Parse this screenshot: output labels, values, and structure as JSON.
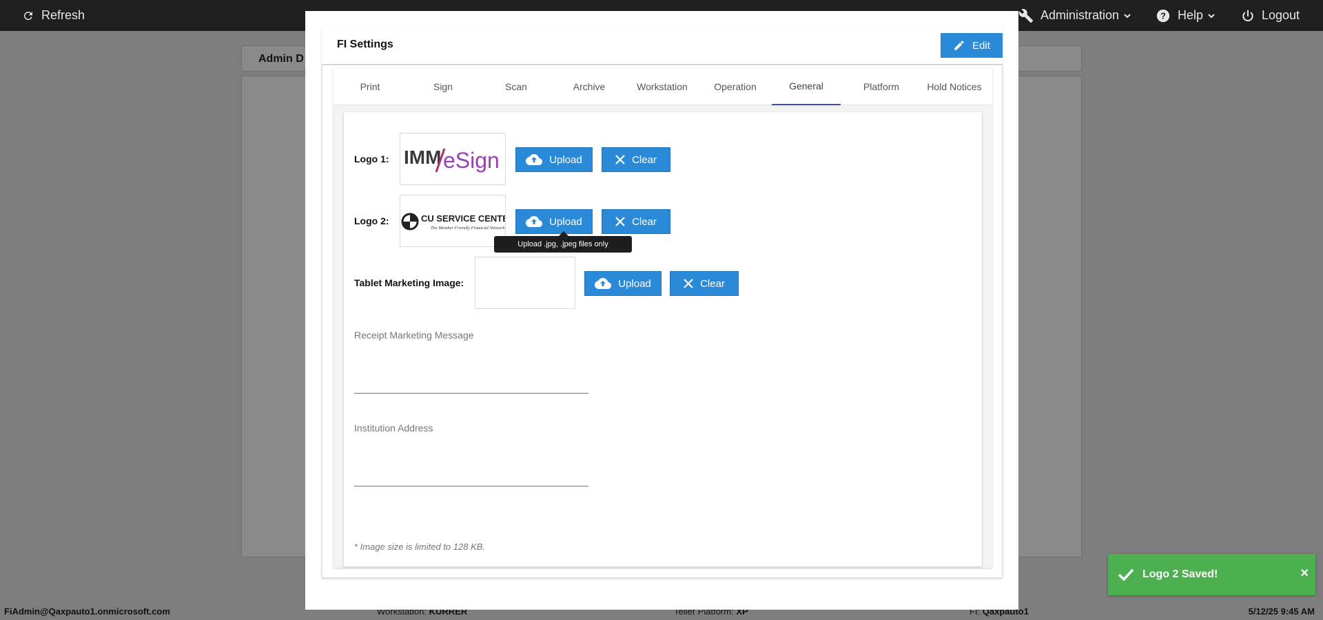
{
  "topbar": {
    "refresh_label": "Refresh",
    "admin_label": "Administration",
    "help_label": "Help",
    "logout_label": "Logout"
  },
  "background": {
    "card_title": "Admin D"
  },
  "modal": {
    "title": "FI Settings",
    "edit_label": "Edit",
    "tabs": [
      {
        "label": "Print"
      },
      {
        "label": "Sign"
      },
      {
        "label": "Scan"
      },
      {
        "label": "Archive"
      },
      {
        "label": "Workstation"
      },
      {
        "label": "Operation"
      },
      {
        "label": "General"
      },
      {
        "label": "Platform"
      },
      {
        "label": "Hold Notices"
      }
    ],
    "active_tab": "General",
    "logo1": {
      "label": "Logo 1:",
      "image_text": "IMM/eSign"
    },
    "logo2": {
      "label": "Logo 2:",
      "image_text": "CU SERVICE CENTERS",
      "image_subtext": "The Member Friendly Financial Network"
    },
    "tablet": {
      "label": "Tablet Marketing Image:"
    },
    "upload_label": "Upload",
    "clear_label": "Clear",
    "tooltip": "Upload .jpg, .jpeg files only",
    "receipt_label": "Receipt Marketing Message",
    "receipt_value": "",
    "address_label": "Institution Address",
    "address_value": "",
    "note": "* Image size is limited to 128 KB."
  },
  "toast": {
    "message": "Logo 2 Saved!",
    "close": "×"
  },
  "status": {
    "user": "FiAdmin@Qaxpauto1.onmicrosoft.com",
    "workstation_label": "Workstation:",
    "workstation_value": "KURRER",
    "teller_label": "Teller Platform:",
    "teller_value": "XP",
    "fi_label": "FI:",
    "fi_value": "Qaxpauto1",
    "datetime": "5/12/25 9:45 AM"
  },
  "colors": {
    "primary": "#2b8ad8",
    "success": "#4caf50",
    "topbar": "#1f1f1f",
    "tab_indicator": "#3b4cb8"
  }
}
